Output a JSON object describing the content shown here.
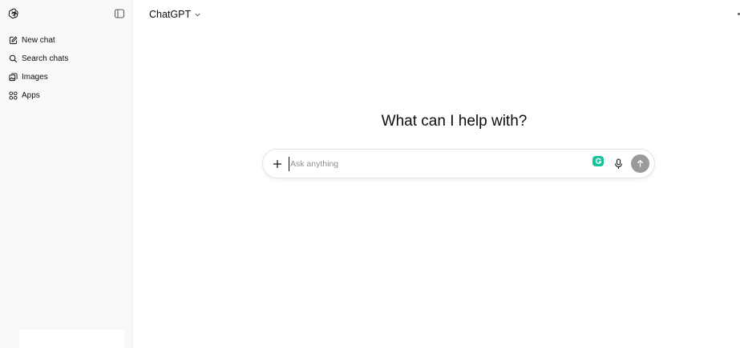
{
  "sidebar": {
    "logo_icon": "openai-logo-icon",
    "toggle_icon": "sidebar-toggle-icon",
    "items": [
      {
        "label": "New chat",
        "icon": "pencil-square-icon"
      },
      {
        "label": "Search chats",
        "icon": "search-icon"
      },
      {
        "label": "Images",
        "icon": "images-icon"
      },
      {
        "label": "Apps",
        "icon": "apps-grid-icon"
      }
    ]
  },
  "header": {
    "model_name": "ChatGPT",
    "model_chevron_icon": "chevron-down-icon"
  },
  "main": {
    "headline": "What can I help with?"
  },
  "composer": {
    "placeholder": "Ask anything",
    "value": "",
    "add_icon": "plus-icon",
    "grammarly_icon": "grammarly-icon",
    "mic_icon": "microphone-icon",
    "send_icon": "arrow-up-icon"
  },
  "colors": {
    "sidebar_bg": "#f9f9f9",
    "send_button_bg": "#9a9a9a",
    "grammarly_green": "#15c39a"
  }
}
